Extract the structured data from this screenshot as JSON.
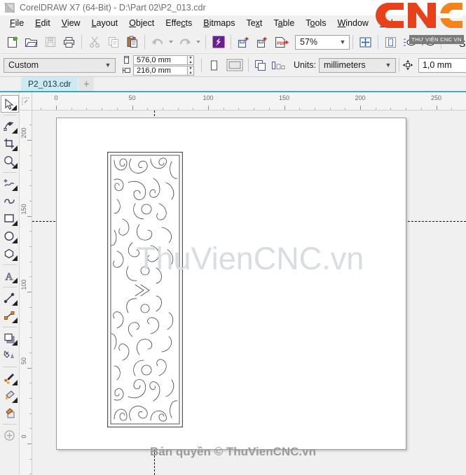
{
  "window": {
    "title": "CorelDRAW X7 (64-Bit) - D:\\Part 02\\P2_013.cdr",
    "app_icon": "corel-logo-icon"
  },
  "menubar": {
    "items": [
      {
        "label": "File",
        "accel": "F"
      },
      {
        "label": "Edit",
        "accel": "E"
      },
      {
        "label": "View",
        "accel": "V"
      },
      {
        "label": "Layout",
        "accel": "L"
      },
      {
        "label": "Object",
        "accel": "O"
      },
      {
        "label": "Effects",
        "accel": "c"
      },
      {
        "label": "Bitmaps",
        "accel": "B"
      },
      {
        "label": "Text",
        "accel": "x"
      },
      {
        "label": "Table",
        "accel": "a"
      },
      {
        "label": "Tools",
        "accel": "o"
      },
      {
        "label": "Window",
        "accel": "W"
      },
      {
        "label": "Help",
        "accel": "H"
      }
    ]
  },
  "toolbar": {
    "buttons": [
      {
        "name": "new-document",
        "icon": "new-page-icon",
        "enabled": true
      },
      {
        "name": "open-document",
        "icon": "open-folder-icon",
        "enabled": true
      },
      {
        "name": "save-document",
        "icon": "floppy-disk-icon",
        "enabled": false
      },
      {
        "name": "print-document",
        "icon": "printer-icon",
        "enabled": true
      },
      {
        "name": "cut",
        "icon": "scissors-icon",
        "enabled": false
      },
      {
        "name": "copy",
        "icon": "copy-icon",
        "enabled": false
      },
      {
        "name": "paste",
        "icon": "clipboard-paste-icon",
        "enabled": true
      },
      {
        "name": "undo",
        "icon": "undo-arrow-icon",
        "enabled": false
      },
      {
        "name": "redo",
        "icon": "redo-arrow-icon",
        "enabled": false
      },
      {
        "name": "corel-connect",
        "icon": "corel-connect-icon",
        "enabled": true
      },
      {
        "name": "import",
        "icon": "import-icon",
        "enabled": true
      },
      {
        "name": "export",
        "icon": "export-icon",
        "enabled": true
      },
      {
        "name": "export-pdf",
        "icon": "pdf-icon",
        "enabled": true
      }
    ],
    "zoom_level": "57%",
    "zoom_dropdown_icon": "chevron-down-icon",
    "fullscreen_preview_icon": "fullscreen-preview-icon",
    "show_rulers_icon": "ruler-icon",
    "show_grid_icon": "grid-eye-icon",
    "show_guidelines_icon": "guideline-eye-icon",
    "edge_label": "S"
  },
  "property_bar": {
    "page_preset": "Custom",
    "page_preset_arrow": "chevron-down-icon",
    "page_width": "576,0 mm",
    "page_height": "216,0 mm",
    "width_icon": "page-width-icon",
    "height_icon": "page-height-icon",
    "orientation_portrait_icon": "portrait-icon",
    "orientation_landscape_icon": "landscape-icon",
    "all_pages_icon": "all-pages-icon",
    "current_page_icon": "current-page-icon",
    "units_label": "Units:",
    "units_value": "millimeters",
    "units_arrow": "chevron-down-icon",
    "nudge_icon": "nudge-arrows-icon",
    "nudge_value": "1,0 mm"
  },
  "tabbar": {
    "documents": [
      {
        "label": "P2_013.cdr",
        "active": true
      }
    ],
    "add_tab_label": "+"
  },
  "toolbox": {
    "tools": [
      {
        "name": "pick-tool",
        "icon": "cursor-arrow-icon",
        "active": true,
        "flyout": true
      },
      {
        "name": "shape-tool",
        "icon": "node-edit-icon",
        "active": false,
        "flyout": true
      },
      {
        "name": "crop-tool",
        "icon": "crop-icon",
        "active": false,
        "flyout": true
      },
      {
        "name": "zoom-tool",
        "icon": "magnifier-icon",
        "active": false,
        "flyout": true
      },
      {
        "name": "freehand-tool",
        "icon": "freehand-curve-icon",
        "active": false,
        "flyout": true
      },
      {
        "name": "smart-drawing-tool",
        "icon": "smart-fill-swirl-icon",
        "active": false,
        "flyout": false
      },
      {
        "name": "rectangle-tool",
        "icon": "rectangle-icon",
        "active": false,
        "flyout": true
      },
      {
        "name": "ellipse-tool",
        "icon": "ellipse-icon",
        "active": false,
        "flyout": true
      },
      {
        "name": "polygon-tool",
        "icon": "polygon-icon",
        "active": false,
        "flyout": true
      },
      {
        "name": "text-tool",
        "icon": "letter-a-icon",
        "active": false,
        "flyout": true
      },
      {
        "name": "parallel-dimension",
        "icon": "dimension-icon",
        "active": false,
        "flyout": true
      },
      {
        "name": "connector-tool",
        "icon": "connector-line-icon",
        "active": false,
        "flyout": true
      },
      {
        "name": "drop-shadow-tool",
        "icon": "drop-shadow-icon",
        "active": false,
        "flyout": true
      },
      {
        "name": "transparency-tool",
        "icon": "transparency-icon",
        "active": false,
        "flyout": false
      },
      {
        "name": "color-eyedropper-tool",
        "icon": "eyedropper-icon",
        "active": false,
        "flyout": true
      },
      {
        "name": "fill-tool",
        "icon": "paint-bucket-icon",
        "active": false,
        "flyout": true
      },
      {
        "name": "interactive-fill-tool",
        "icon": "interactive-fill-icon",
        "active": false,
        "flyout": false
      },
      {
        "name": "quick-customize",
        "icon": "plus-circle-icon",
        "active": false,
        "flyout": false
      }
    ]
  },
  "rulers": {
    "unit": "mm",
    "horizontal_labels": [
      "0",
      "50",
      "100",
      "150",
      "200",
      "250"
    ],
    "vertical_labels": [
      "200",
      "150",
      "100",
      "50",
      "0"
    ],
    "origin_icon": "ruler-origin-icon"
  },
  "canvas": {
    "document_page": {
      "background": "#ffffff",
      "border_color": "#9a9a9a"
    },
    "artwork": {
      "name": "decorative-scroll-panel",
      "description": "Rectangular CNC cut panel with symmetric swirl / spiral scroll ornament, thin black outlines on white",
      "stroke_color": "#3c3c3c",
      "fill_color": "#ffffff"
    }
  },
  "watermarks": {
    "canvas_text": "ThuVienCNC.vn",
    "canvas_color": "#d9dde2",
    "bottom_text": "Bản quyền © ThuVienCNC.vn",
    "bottom_color": "#9a9a9a",
    "logo_text": "CNC",
    "logo_color_dark": "#e03b13",
    "logo_color_light": "#f07d1e",
    "logo_subtitle": "THƯ VIỆN CNC VN",
    "tooltip_text": "THƯ VIỆN CNC VN"
  }
}
